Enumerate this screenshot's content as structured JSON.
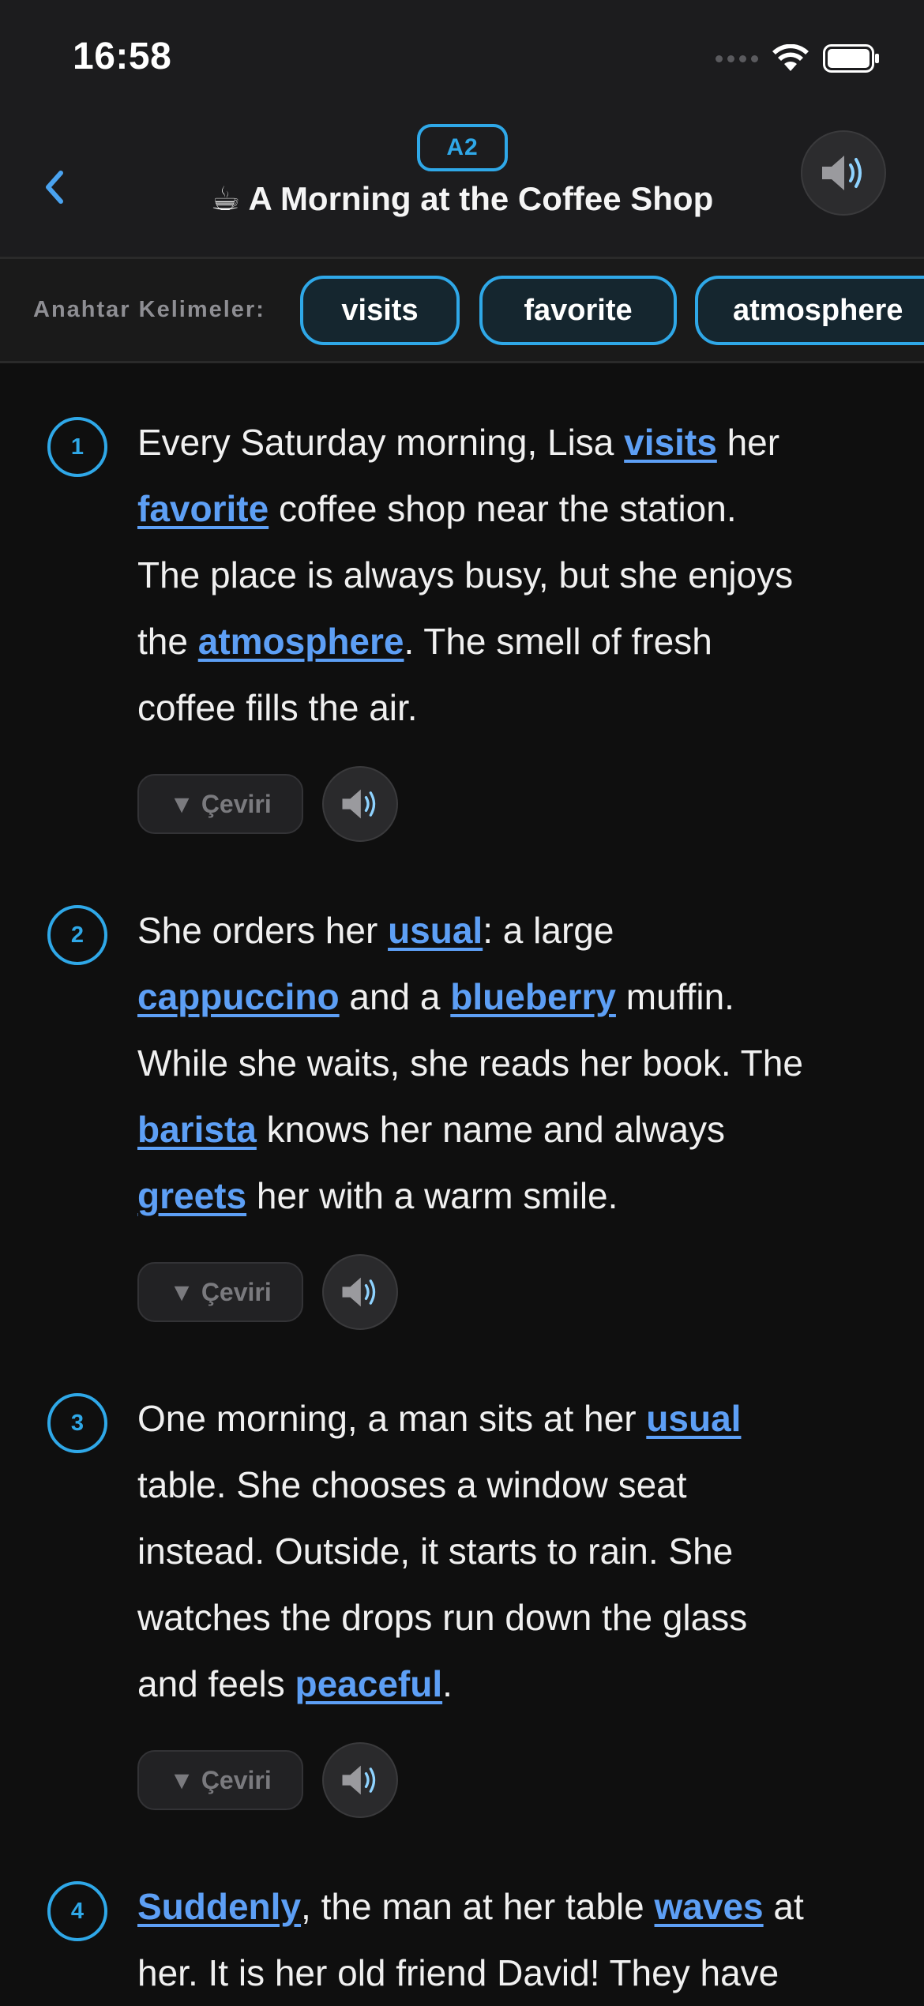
{
  "status_bar": {
    "time": "16:58"
  },
  "header": {
    "level": "A2",
    "title": "☕ A Morning at the Coffee Shop"
  },
  "keywords": {
    "label": "Anahtar Kelimeler:",
    "chips": [
      "visits",
      "favorite",
      "atmosphere"
    ]
  },
  "translate_label": "▼ Çeviri",
  "paragraphs": [
    {
      "number": "1",
      "lines": [
        [
          {
            "t": "Every Saturday morning, Lisa "
          },
          {
            "k": "visits"
          },
          {
            "t": " her"
          }
        ],
        [
          {
            "k": "favorite"
          },
          {
            "t": " coffee shop near the station."
          }
        ],
        [
          {
            "t": "The place is always busy, but she enjoys"
          }
        ],
        [
          {
            "t": "the "
          },
          {
            "k": "atmosphere"
          },
          {
            "t": ". The smell of fresh"
          }
        ],
        [
          {
            "t": "coffee fills the air."
          }
        ]
      ]
    },
    {
      "number": "2",
      "lines": [
        [
          {
            "t": "She orders her "
          },
          {
            "k": "usual"
          },
          {
            "t": ": a large"
          }
        ],
        [
          {
            "k": "cappuccino"
          },
          {
            "t": " and a "
          },
          {
            "k": "blueberry"
          },
          {
            "t": " muffin."
          }
        ],
        [
          {
            "t": "While she waits, she reads her book. The"
          }
        ],
        [
          {
            "k": "barista"
          },
          {
            "t": " knows her name and always"
          }
        ],
        [
          {
            "k": "greets"
          },
          {
            "t": " her with a warm smile."
          }
        ]
      ]
    },
    {
      "number": "3",
      "lines": [
        [
          {
            "t": "One morning, a man sits at her "
          },
          {
            "k": "usual"
          }
        ],
        [
          {
            "t": "table. She chooses a window seat"
          }
        ],
        [
          {
            "t": "instead. Outside, it starts to rain. She"
          }
        ],
        [
          {
            "t": "watches the drops run down the glass"
          }
        ],
        [
          {
            "t": "and feels "
          },
          {
            "k": "peaceful"
          },
          {
            "t": "."
          }
        ]
      ]
    },
    {
      "number": "4",
      "lines": [
        [
          {
            "k": "Suddenly"
          },
          {
            "t": ", the man at her table "
          },
          {
            "k": "waves"
          },
          {
            "t": " at"
          }
        ],
        [
          {
            "t": "her. It is her old friend David! They have"
          }
        ]
      ]
    }
  ]
}
